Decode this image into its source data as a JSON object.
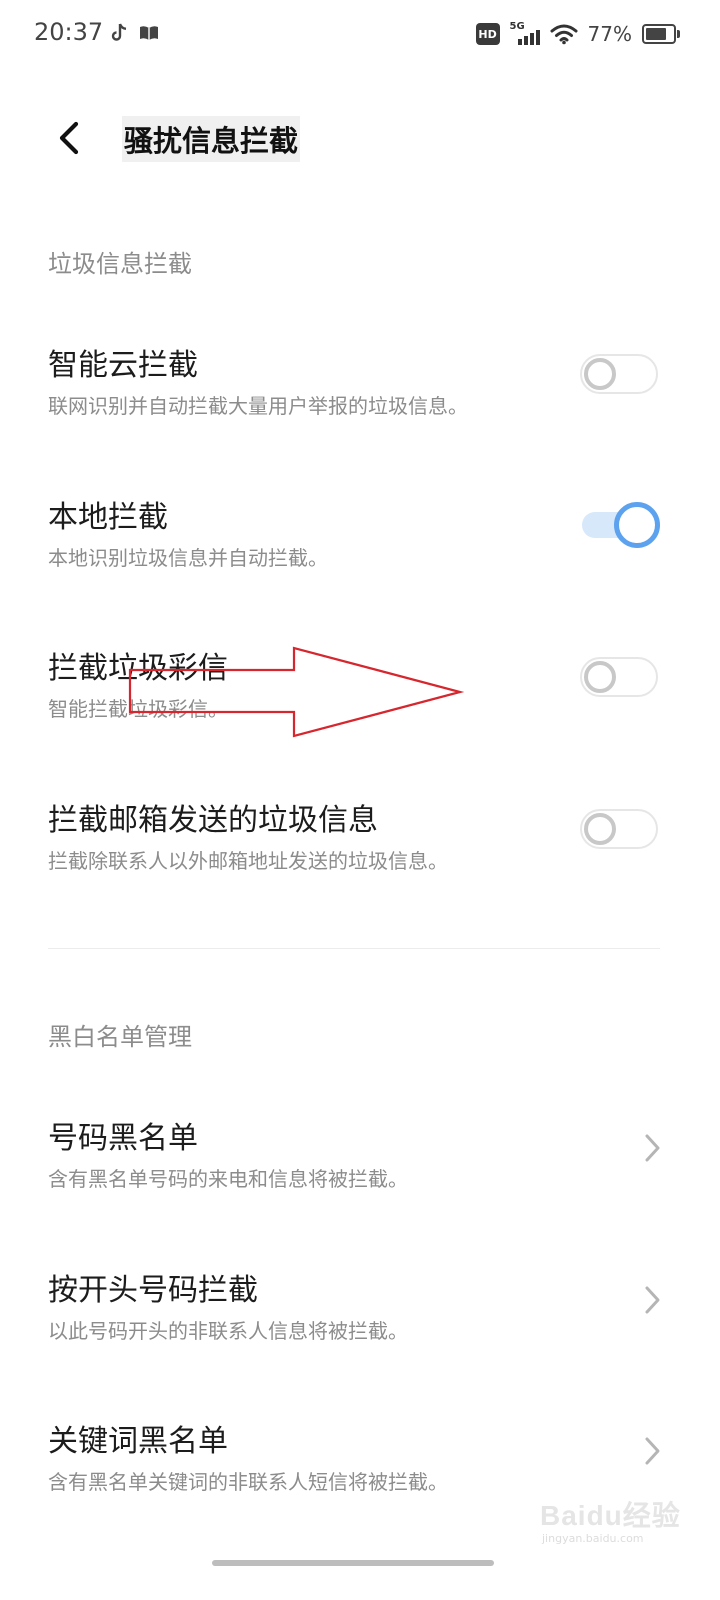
{
  "status_bar": {
    "time": "20:37",
    "network": "5G",
    "hd_badge": "HD",
    "battery_percent": "77%",
    "battery_level": 0.77,
    "app_icons": [
      "tiktok-icon",
      "book-icon"
    ]
  },
  "header": {
    "back_icon": "chevron-left-icon",
    "title": "骚扰信息拦截"
  },
  "spam_section": {
    "header": "垃圾信息拦截",
    "items": [
      {
        "title": "智能云拦截",
        "subtitle": "联网识别并自动拦截大量用户举报的垃圾信息。",
        "enabled": false
      },
      {
        "title": "本地拦截",
        "subtitle": "本地识别垃圾信息并自动拦截。",
        "enabled": true
      },
      {
        "title": "拦截垃圾彩信",
        "subtitle": "智能拦截垃圾彩信。",
        "enabled": false
      },
      {
        "title": "拦截邮箱发送的垃圾信息",
        "subtitle": "拦截除联系人以外邮箱地址发送的垃圾信息。",
        "enabled": false
      }
    ]
  },
  "blacklist_section": {
    "header": "黑白名单管理",
    "items": [
      {
        "title": "号码黑名单",
        "subtitle": "含有黑名单号码的来电和信息将被拦截。"
      },
      {
        "title": "按开头号码拦截",
        "subtitle": "以此号码开头的非联系人信息将被拦截。"
      },
      {
        "title": "关键词黑名单",
        "subtitle": "含有黑名单关键词的非联系人短信将被拦截。"
      }
    ]
  },
  "colors": {
    "switch_on": "#5da2ef",
    "switch_on_track": "#d7e8fb",
    "switch_off": "#c8c8c8",
    "annotation": "#d6262e"
  },
  "watermark": {
    "brand": "Baidu经验",
    "url": "jingyan.baidu.com"
  }
}
